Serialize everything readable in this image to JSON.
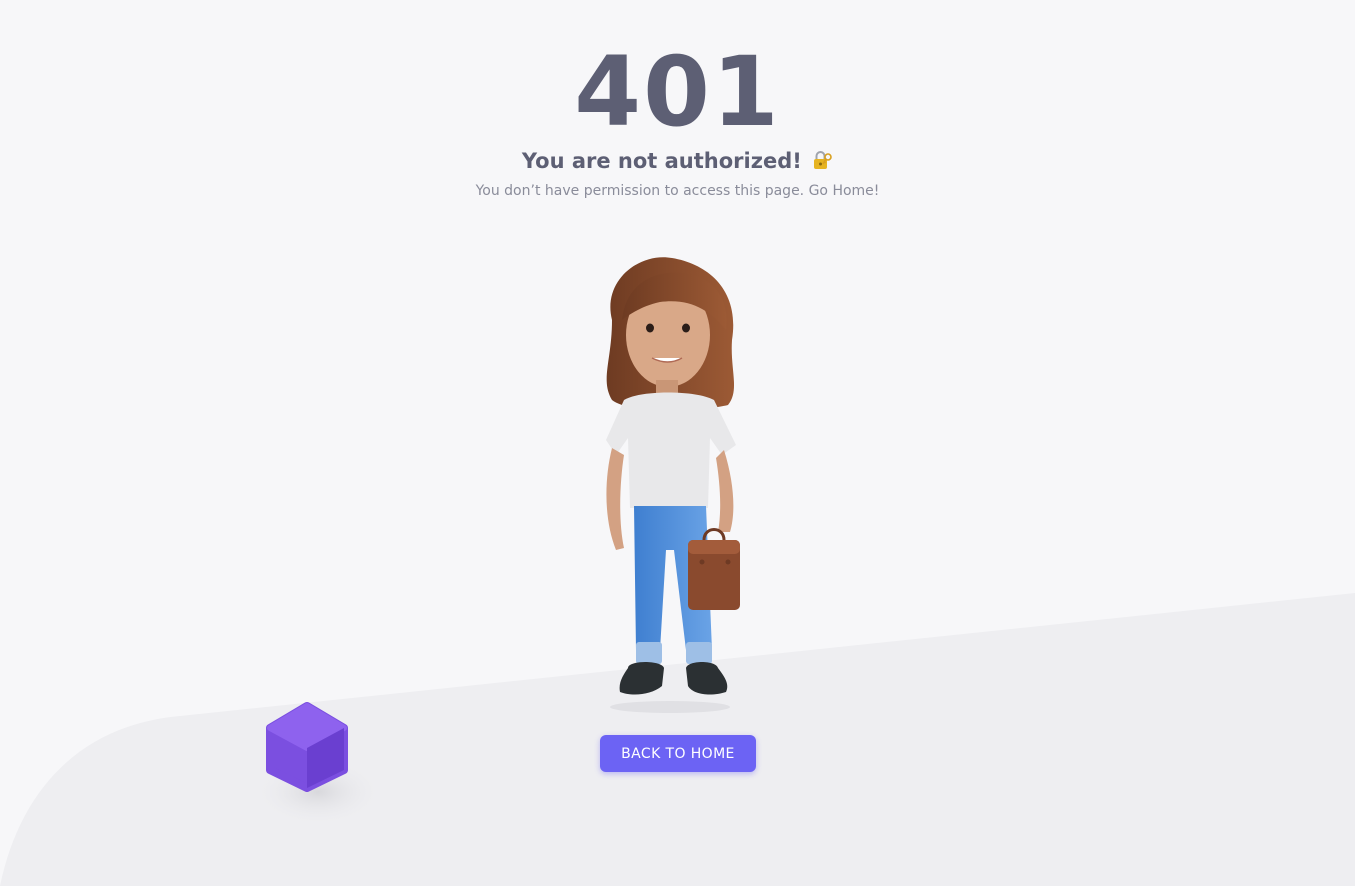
{
  "error": {
    "code": "401",
    "title": "You are not authorized!",
    "title_icon": "lock-key-icon",
    "message": "You don’t have permission to access this page. Go Home!"
  },
  "actions": {
    "back_label": "BACK TO HOME"
  },
  "illustration": {
    "subject": "girl-with-briefcase-illustration",
    "decoration": "purple-cube-icon"
  },
  "colors": {
    "background": "#f7f7f9",
    "floor": "#eeeef1",
    "heading": "#5d5f74",
    "muted": "#8a8c9a",
    "primary": "#6c63f4"
  }
}
